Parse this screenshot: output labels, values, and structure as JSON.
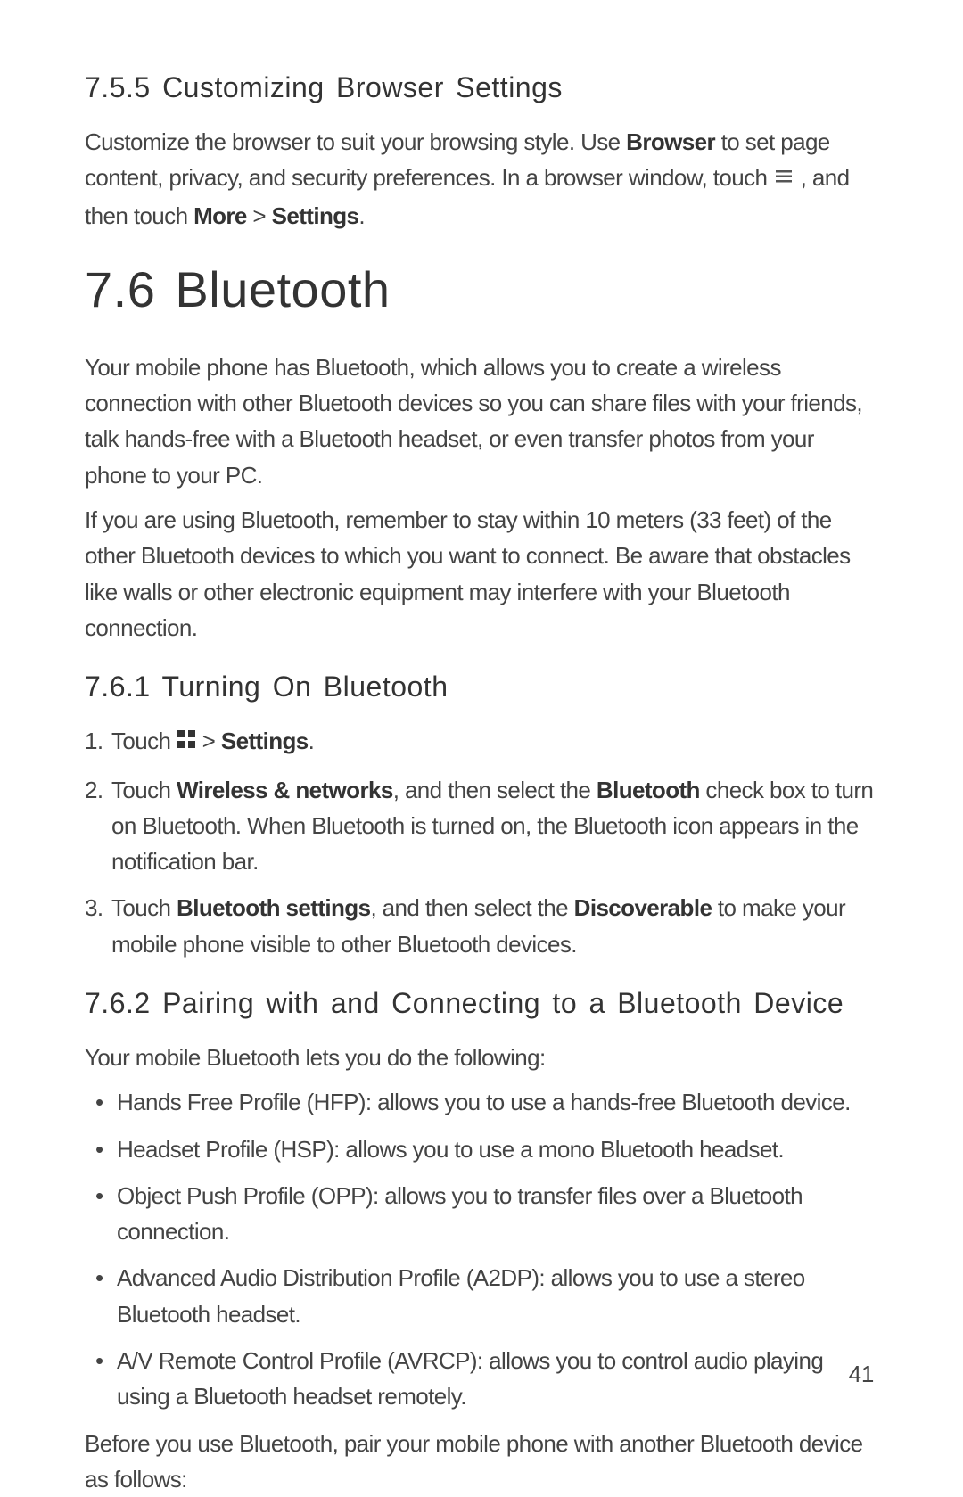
{
  "section_755": {
    "heading": "7.5.5  Customizing Browser Settings",
    "para_a": "Customize the browser to suit your browsing style. Use ",
    "browser_bold": "Browser",
    "para_b": " to set page content, privacy, and security preferences. In a browser window, touch  ",
    "para_c": "  , and then touch ",
    "more_bold": "More",
    "gt": " > ",
    "settings_bold": "Settings",
    "para_end": "."
  },
  "section_76": {
    "heading": "7.6  Bluetooth",
    "para1": "Your mobile phone has Bluetooth, which allows you to create a wireless connection with other Bluetooth devices so you can share files with your friends, talk hands-free with a Bluetooth headset, or even transfer photos from your phone to your PC.",
    "para2": "If you are using Bluetooth, remember to stay within 10 meters (33 feet) of the other Bluetooth devices to which you want to connect. Be aware that obstacles like walls or other electronic equipment may interfere with your Bluetooth connection."
  },
  "section_761": {
    "heading": "7.6.1  Turning On Bluetooth",
    "step1_a": "Touch  ",
    "step1_b": "  > ",
    "step1_settings": "Settings",
    "step1_end": ".",
    "step2_a": "Touch ",
    "step2_wn": "Wireless & networks",
    "step2_b": ", and then select the ",
    "step2_bt": "Bluetooth",
    "step2_c": " check box to turn on Bluetooth. When Bluetooth is turned on, the Bluetooth icon appears in the notification bar.",
    "step3_a": "Touch ",
    "step3_bs": "Bluetooth settings",
    "step3_b": ", and then select the ",
    "step3_disc": "Discoverable",
    "step3_c": " to make your mobile phone visible to other Bluetooth devices."
  },
  "section_762": {
    "heading": "7.6.2  Pairing with and Connecting to a Bluetooth Device",
    "intro": "Your mobile Bluetooth lets you do the following:",
    "bullets": [
      "Hands Free Profile (HFP): allows you to use a hands-free Bluetooth device.",
      "Headset Profile (HSP): allows you to use a mono Bluetooth headset.",
      "Object Push Profile (OPP): allows you to transfer files over a Bluetooth connection.",
      "Advanced Audio Distribution Profile (A2DP): allows you to use a stereo Bluetooth headset.",
      "A/V Remote Control Profile (AVRCP): allows you to control audio playing using a Bluetooth headset remotely."
    ],
    "after": "Before you use Bluetooth, pair your mobile phone with another Bluetooth device as follows:"
  },
  "nums": {
    "n1": "1.",
    "n2": "2.",
    "n3": "3."
  },
  "page_number": "41"
}
